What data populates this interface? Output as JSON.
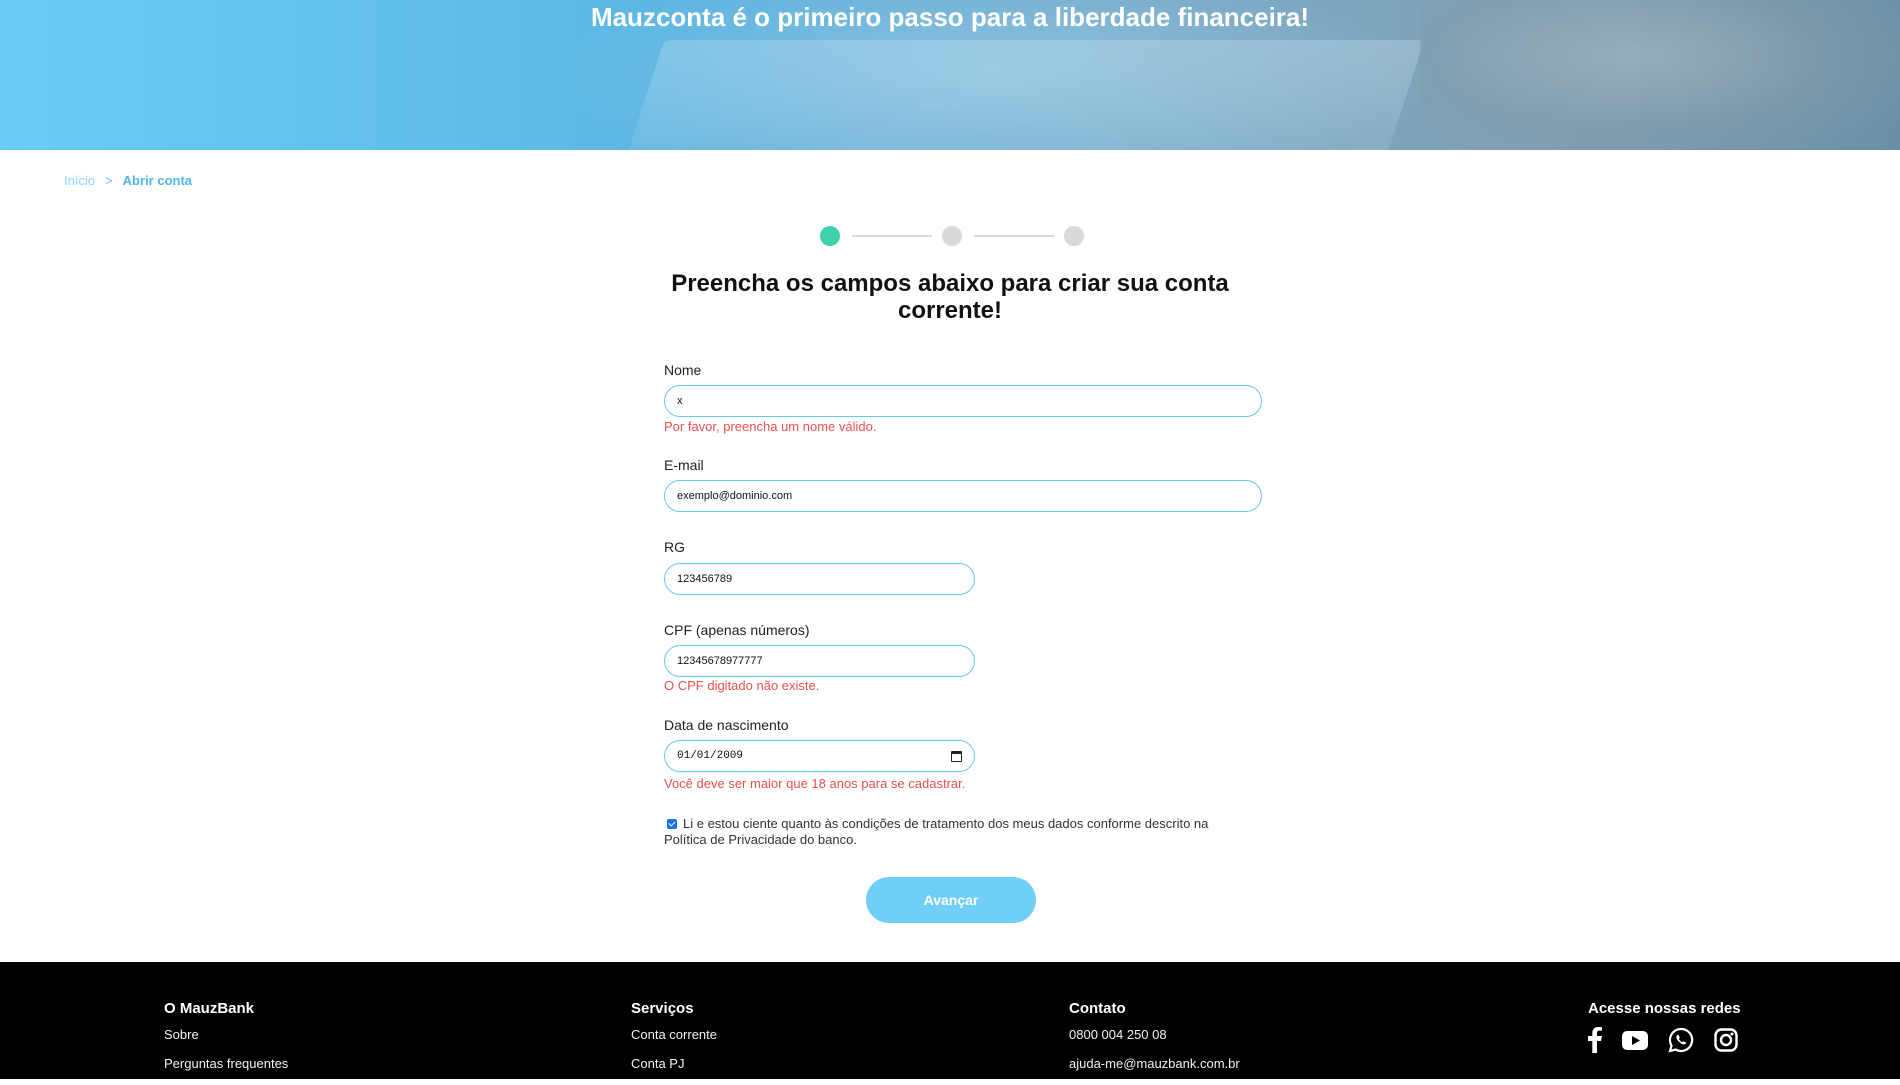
{
  "hero": {
    "title": "Mauzconta é o primeiro passo para a liberdade financeira!"
  },
  "breadcrumb": {
    "home": "Início",
    "separator": ">",
    "current": "Abrir conta"
  },
  "stepper": {
    "current_step": 1,
    "total_steps": 3
  },
  "form": {
    "title": "Preencha os campos abaixo para criar sua conta corrente!",
    "fields": {
      "nome": {
        "label": "Nome",
        "value": "x",
        "error": "Por favor, preencha um nome válido."
      },
      "email": {
        "label": "E-mail",
        "value": "exemplo@dominio.com"
      },
      "rg": {
        "label": "RG",
        "value": "123456789"
      },
      "cpf": {
        "label": "CPF (apenas números)",
        "value": "12345678977777",
        "error": "O CPF digitado não existe."
      },
      "nascimento": {
        "label": "Data de nascimento",
        "value": "01/01/2009",
        "error": "Você deve ser maior que 18 anos para se cadastrar."
      }
    },
    "consent": {
      "checked": true,
      "text": "Li e estou ciente quanto às condições de tratamento dos meus dados conforme descrito na Política de Privacidade do banco."
    },
    "submit_label": "Avançar"
  },
  "footer": {
    "about": {
      "heading": "O MauzBank",
      "links": [
        "Sobre",
        "Perguntas frequentes"
      ]
    },
    "services": {
      "heading": "Serviços",
      "links": [
        "Conta corrente",
        "Conta PJ"
      ]
    },
    "contact": {
      "heading": "Contato",
      "phone": "0800 004 250 08",
      "email": "ajuda-me@mauzbank.com.br"
    },
    "social": {
      "heading": "Acesse nossas redes",
      "icons": [
        "facebook-icon",
        "youtube-icon",
        "whatsapp-icon",
        "instagram-icon"
      ]
    }
  },
  "colors": {
    "accent": "#6fcff8",
    "step_active": "#3fd1a9",
    "error": "#e8504f",
    "footer_bg": "#000000"
  }
}
